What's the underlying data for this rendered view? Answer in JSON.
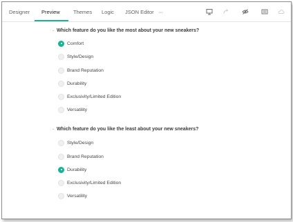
{
  "tabs": [
    {
      "label": "Designer",
      "active": false
    },
    {
      "label": "Preview",
      "active": true
    },
    {
      "label": "Themes",
      "active": false
    },
    {
      "label": "Logic",
      "active": false
    },
    {
      "label": "JSON Editor",
      "active": false
    }
  ],
  "more_label": "···",
  "toolbar_icons": [
    "device-icon",
    "redo-icon",
    "eye-off-icon",
    "book-icon",
    "cloud-icon"
  ],
  "accent_color": "#19b394",
  "questions": [
    {
      "title": "Which feature do you like the most about your new sneakers?",
      "collapse_icon": "collapse-chevron-icon",
      "options": [
        {
          "label": "Comfort",
          "checked": true
        },
        {
          "label": "Style/Design",
          "checked": false
        },
        {
          "label": "Brand Reputation",
          "checked": false
        },
        {
          "label": "Durability",
          "checked": false
        },
        {
          "label": "Exclusivity/Limited Edition",
          "checked": false
        },
        {
          "label": "Versatility",
          "checked": false
        }
      ]
    },
    {
      "title": "Which feature do you like the least about your new sneakers?",
      "collapse_icon": "collapse-chevron-icon",
      "options": [
        {
          "label": "Style/Design",
          "checked": false
        },
        {
          "label": "Brand Reputation",
          "checked": false
        },
        {
          "label": "Durability",
          "checked": true
        },
        {
          "label": "Exclusivity/Limited Edition",
          "checked": false
        },
        {
          "label": "Versatility",
          "checked": false
        }
      ]
    }
  ]
}
